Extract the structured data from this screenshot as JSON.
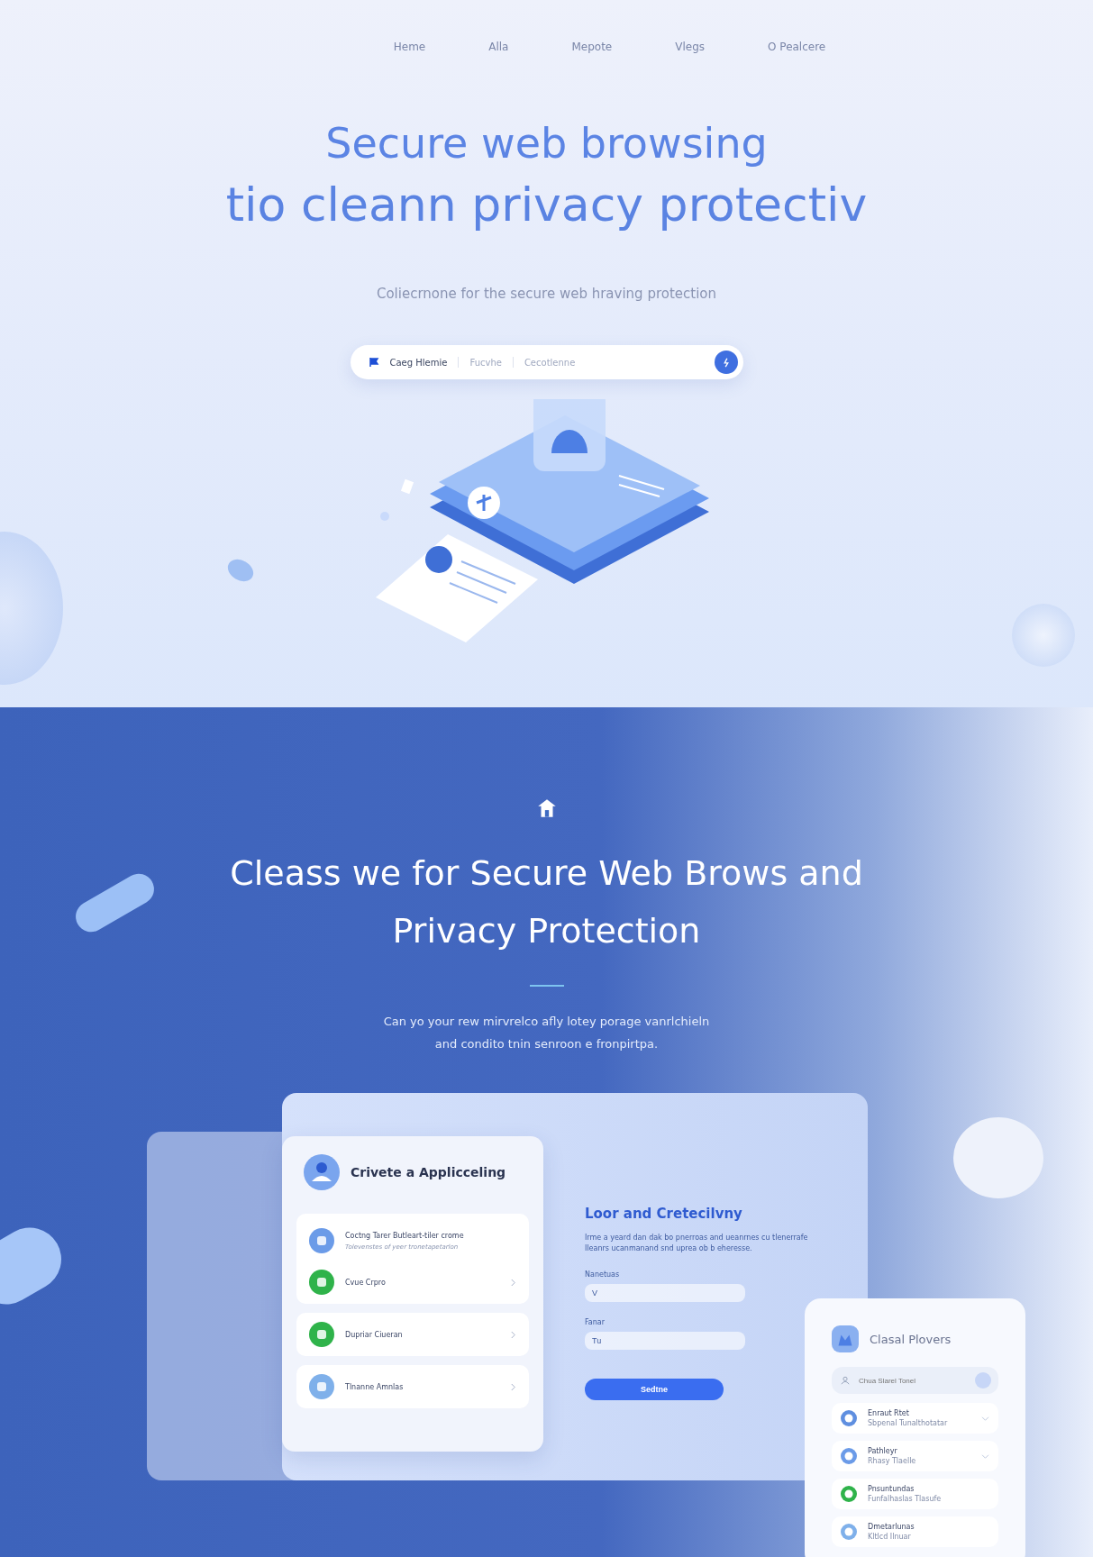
{
  "nav": {
    "items": [
      {
        "label": "Heme"
      },
      {
        "label": "Alla"
      },
      {
        "label": "Mepote"
      },
      {
        "label": "Vlegs"
      },
      {
        "label": "O Pealcere"
      }
    ]
  },
  "hero": {
    "title_lines": [
      "Secure web browsing",
      "tio cleann privacy protectiv"
    ],
    "subtitle": "Coliecrnone for the secure web hraving protection",
    "search": {
      "segments": [
        "Caeg Hlemie",
        "Fucvhe",
        "Cecotlenne"
      ]
    }
  },
  "feature": {
    "title_lines": [
      "Cleass we for Secure Web Brows and",
      "Privacy Protection"
    ],
    "text_lines": [
      "Can yo your rew mirvrelco afly lotey porage vanrlchieln",
      "and condito tnin senroon e fronpirtpa."
    ]
  },
  "app_panel": {
    "title": "Crivete a Applicceling",
    "cards": [
      {
        "rows": [
          {
            "kind": "detail",
            "title": "Coctng Tarer Butleart-tiler crome",
            "subtitle": "Tolevenstes of yeer tronetapetarlon"
          },
          {
            "kind": "link",
            "title": "Cvue Crpro"
          }
        ]
      },
      {
        "rows": [
          {
            "kind": "link",
            "title": "Dupriar Ciueran"
          }
        ]
      },
      {
        "rows": [
          {
            "kind": "link",
            "title": "Tlnanne Amnlas"
          }
        ]
      }
    ]
  },
  "form": {
    "title": "Loor and Cretecilvny",
    "description": "Irme a yeard dan dak bo pnerroas and ueanrnes cu tlenerrafe Ileanrs ucanmanand snd uprea ob b eheresse.",
    "fields": [
      {
        "label": "Nanetuas",
        "value": "V"
      },
      {
        "label": "Fanar",
        "value": "Tu"
      }
    ],
    "button": "Sedtne"
  },
  "side_card": {
    "title": "Clasal Plovers",
    "search": {
      "placeholder": "Chua Slarel Tonel"
    },
    "items": [
      {
        "title": "Enraut Rtet",
        "subtitle": "Sbpenal Tunalthotatar",
        "chevron": true
      },
      {
        "title": "Pathleyr",
        "subtitle": "Rhasy Tlaelle",
        "chevron": true
      },
      {
        "title": "Pnsuntundas",
        "subtitle": "Funfalhaslas Tlasufe",
        "chevron": false
      },
      {
        "title": "Dmetarlunas",
        "subtitle": "Kltlcd Ilnuar",
        "chevron": false
      }
    ]
  }
}
